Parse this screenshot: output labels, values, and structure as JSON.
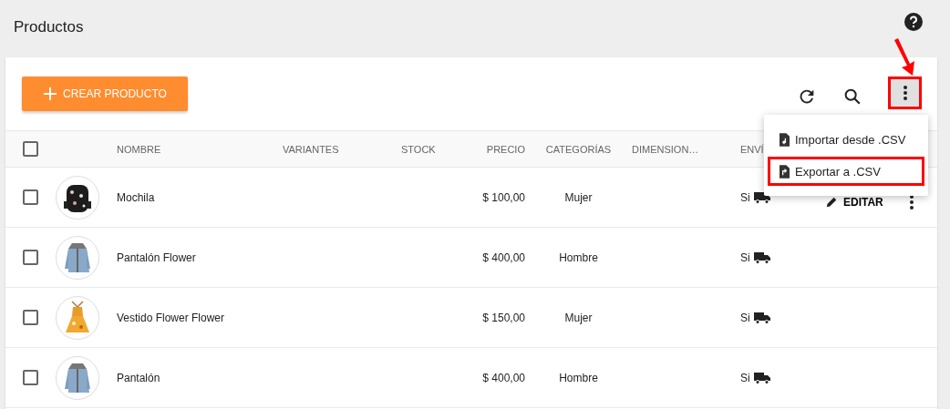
{
  "page": {
    "title": "Productos"
  },
  "toolbar": {
    "create_button": "CREAR PRODUCTO",
    "more_button": {
      "highlighted": true
    }
  },
  "menu": {
    "items": [
      {
        "kind": "import",
        "label": "Importar desde .CSV",
        "highlighted": false
      },
      {
        "kind": "export",
        "label": "Exportar a .CSV",
        "highlighted": true
      }
    ]
  },
  "table": {
    "select_all": {
      "checked": false
    },
    "columns": [
      "NOMBRE",
      "VARIANTES",
      "STOCK",
      "PRECIO",
      "CATEGORÍAS",
      "DIMENSION…",
      "ENVÍ"
    ],
    "rows": [
      {
        "checked": false,
        "name": "Mochila",
        "price": "$ 100,00",
        "category": "Mujer",
        "shipping": "Si",
        "action": "EDITAR",
        "show_actions": true
      },
      {
        "checked": false,
        "name": "Pantalón Flower",
        "price": "$ 400,00",
        "category": "Hombre",
        "shipping": "Si",
        "show_actions": false
      },
      {
        "checked": false,
        "name": "Vestido Flower Flower",
        "price": "$ 150,00",
        "category": "Mujer",
        "shipping": "Si",
        "show_actions": false
      },
      {
        "checked": false,
        "name": "Pantalón",
        "price": "$ 400,00",
        "category": "Hombre",
        "shipping": "Si",
        "show_actions": false
      }
    ]
  }
}
